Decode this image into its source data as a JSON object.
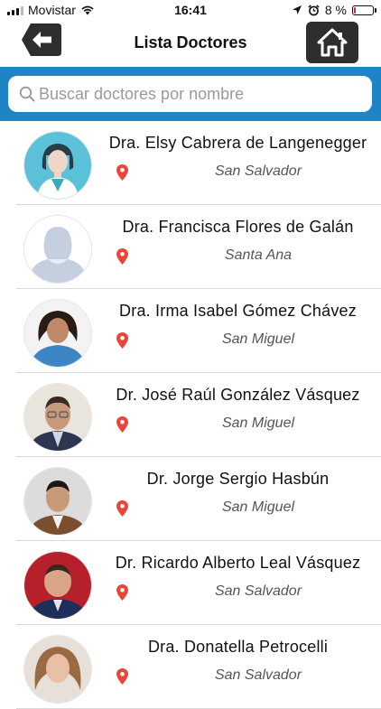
{
  "status_bar": {
    "carrier": "Movistar",
    "time": "16:41",
    "battery_percent_label": "8 %",
    "battery_level": 0.08
  },
  "nav": {
    "title": "Lista Doctores",
    "back_icon": "back-arrow-icon",
    "home_icon": "home-icon"
  },
  "search": {
    "placeholder": "Buscar doctores por nombre",
    "value": ""
  },
  "colors": {
    "accent": "#1d84c5",
    "pin": "#e8463a",
    "home_button": "#2e2e2e"
  },
  "doctors": [
    {
      "name": "Dra. Elsy  Cabrera de Langenegger",
      "city": "San Salvador"
    },
    {
      "name": "Dra. Francisca  Flores de Galán",
      "city": "Santa Ana"
    },
    {
      "name": "Dra. Irma Isabel  Gómez Chávez",
      "city": "San Miguel"
    },
    {
      "name": "Dr. José Raúl González Vásquez",
      "city": "San Miguel"
    },
    {
      "name": "Dr. Jorge Sergio  Hasbún",
      "city": "San Miguel"
    },
    {
      "name": "Dr. Ricardo Alberto Leal Vásquez",
      "city": "San Salvador"
    },
    {
      "name": "Dra. Donatella  Petrocelli",
      "city": "San Salvador"
    }
  ]
}
